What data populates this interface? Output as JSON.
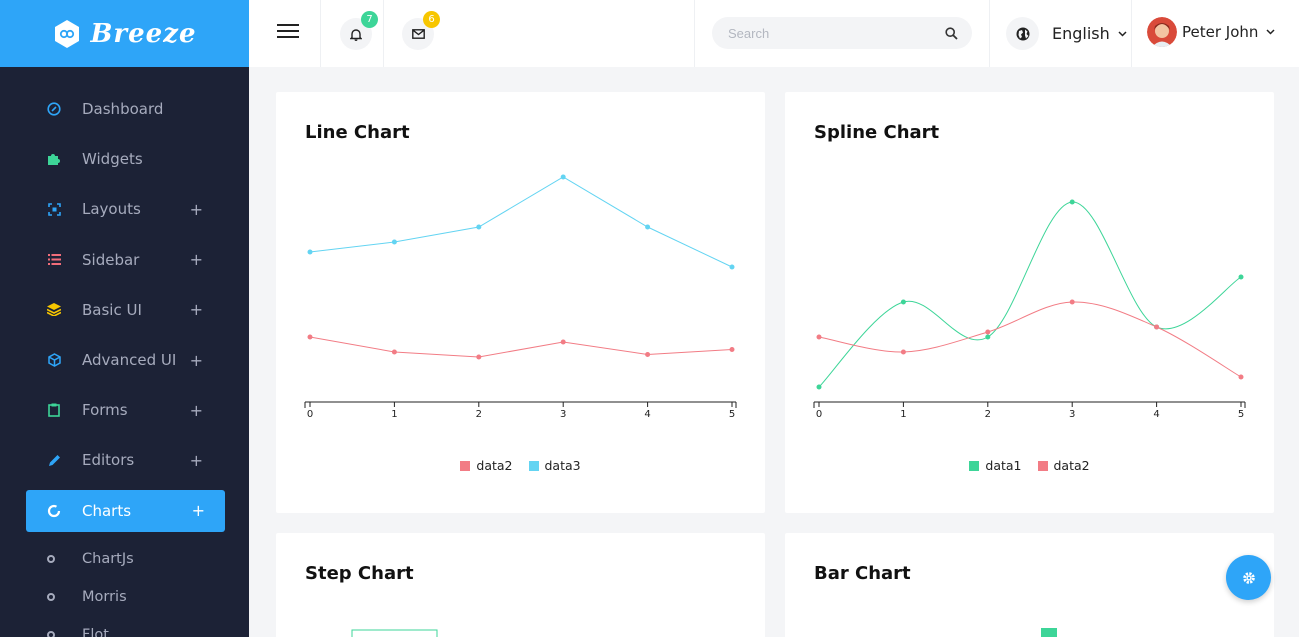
{
  "brand": {
    "name": "Breeze"
  },
  "sidebar": {
    "items": [
      {
        "label": "Dashboard",
        "icon": "gauge-icon",
        "color": "#2ea5f8",
        "expandable": false
      },
      {
        "label": "Widgets",
        "icon": "puzzle-icon",
        "color": "#3dd598",
        "expandable": false
      },
      {
        "label": "Layouts",
        "icon": "expand-icon",
        "color": "#2ea5f8",
        "expandable": true
      },
      {
        "label": "Sidebar",
        "icon": "list-icon",
        "color": "#f06d7a",
        "expandable": true
      },
      {
        "label": "Basic UI",
        "icon": "layers-icon",
        "color": "#f7c600",
        "expandable": true
      },
      {
        "label": "Advanced UI",
        "icon": "cube-icon",
        "color": "#2ea5f8",
        "expandable": true
      },
      {
        "label": "Forms",
        "icon": "clipboard-icon",
        "color": "#3dd598",
        "expandable": true
      },
      {
        "label": "Editors",
        "icon": "pencil-icon",
        "color": "#2ea5f8",
        "expandable": true
      },
      {
        "label": "Charts",
        "icon": "donut-icon",
        "color": "#ffffff",
        "expandable": true,
        "active": true
      }
    ],
    "plus_symbol": "+",
    "sub_items": [
      {
        "label": "ChartJs"
      },
      {
        "label": "Morris"
      },
      {
        "label": "Flot"
      }
    ]
  },
  "header": {
    "notifications": {
      "count": "7",
      "badge_color": "#3dd598"
    },
    "messages": {
      "count": "6",
      "badge_color": "#f7c600"
    },
    "search": {
      "placeholder": "Search"
    },
    "language": {
      "label": "English"
    },
    "user": {
      "name": "Peter John"
    }
  },
  "cards": {
    "line": {
      "title": "Line Chart"
    },
    "spline": {
      "title": "Spline Chart"
    },
    "step": {
      "title": "Step Chart"
    },
    "bar": {
      "title": "Bar Chart"
    }
  },
  "colors": {
    "accent": "#2ea5f8",
    "data1": "#3dd598",
    "data2": "#f27c85",
    "data3": "#63d4f2"
  },
  "chart_data": [
    {
      "type": "line",
      "title": "Line Chart",
      "x": [
        0,
        1,
        2,
        3,
        4,
        5
      ],
      "ylim": [
        0,
        460
      ],
      "series": [
        {
          "name": "data2",
          "color": "#f27c85",
          "values": [
            130,
            100,
            90,
            120,
            95,
            105
          ]
        },
        {
          "name": "data3",
          "color": "#63d4f2",
          "values": [
            300,
            320,
            350,
            450,
            350,
            270
          ]
        }
      ],
      "legend": "bottom"
    },
    {
      "type": "line",
      "subtype": "spline",
      "title": "Spline Chart",
      "x": [
        0,
        1,
        2,
        3,
        4,
        5
      ],
      "ylim": [
        0,
        460
      ],
      "series": [
        {
          "name": "data1",
          "color": "#3dd598",
          "values": [
            30,
            200,
            130,
            400,
            150,
            250
          ]
        },
        {
          "name": "data2",
          "color": "#f27c85",
          "values": [
            130,
            100,
            140,
            200,
            150,
            50
          ]
        }
      ],
      "legend": "bottom"
    }
  ]
}
